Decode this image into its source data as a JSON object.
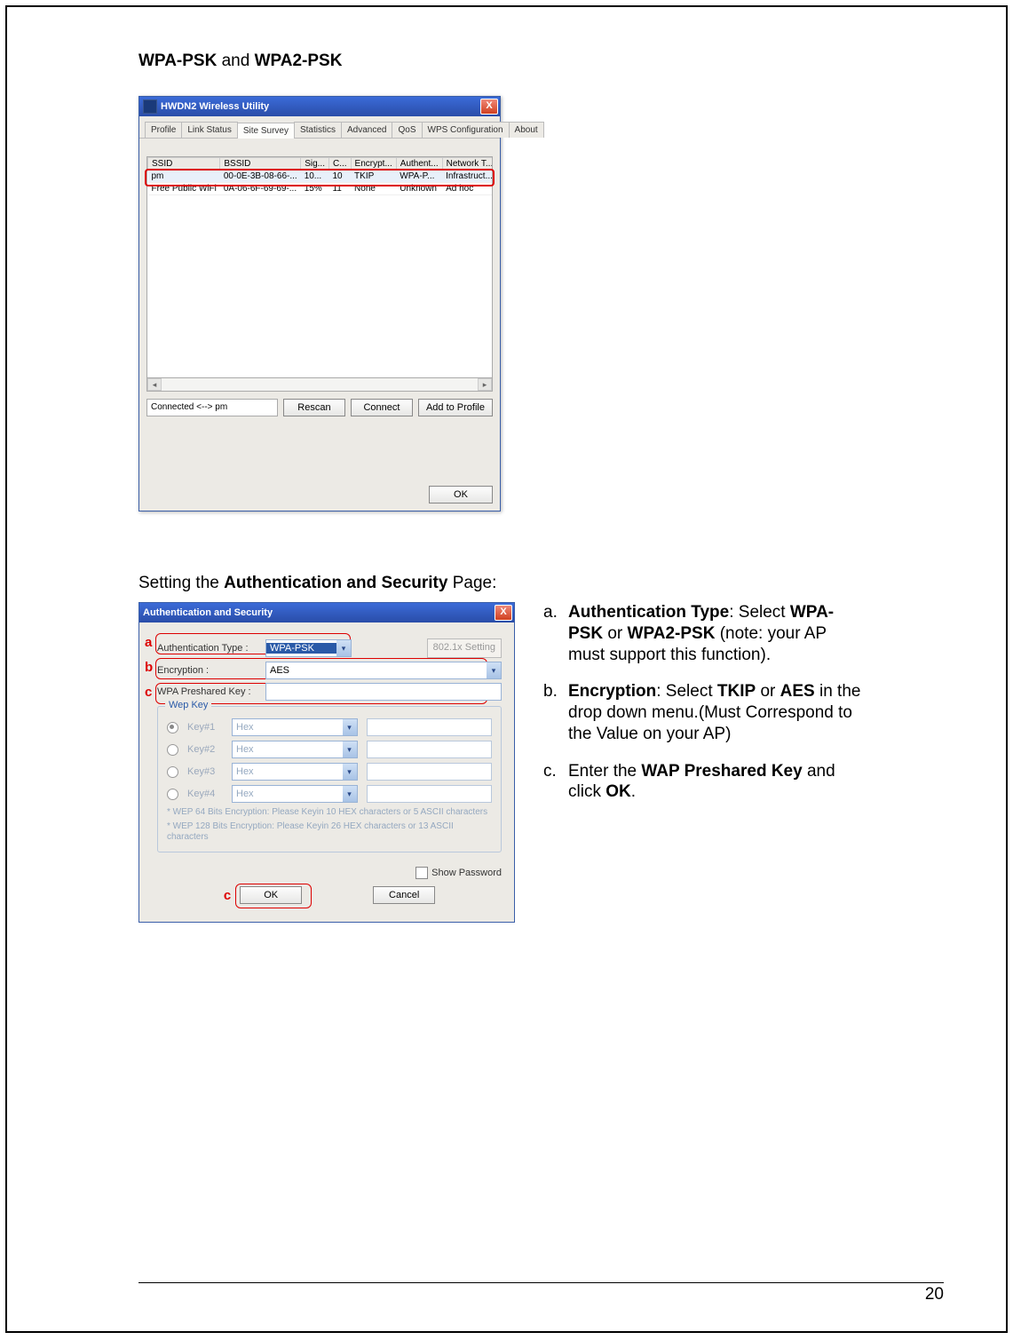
{
  "heading": {
    "p1": "WPA-PSK",
    "p2": " and ",
    "p3": "WPA2-PSK"
  },
  "win1": {
    "title": "HWDN2 Wireless Utility",
    "close": "X",
    "tabs": [
      "Profile",
      "Link Status",
      "Site Survey",
      "Statistics",
      "Advanced",
      "QoS",
      "WPS Configuration",
      "About"
    ],
    "activeTab": 2,
    "headers": [
      "SSID",
      "BSSID",
      "Sig...",
      "C...",
      "Encrypt...",
      "Authent...",
      "Network T..."
    ],
    "rows": [
      {
        "ssid": "pm",
        "bssid": "00-0E-3B-08-66-...",
        "sig": "10...",
        "ch": "10",
        "enc": "TKIP",
        "auth": "WPA-P...",
        "net": "Infrastruct..."
      },
      {
        "ssid": "Free Public WiFi",
        "bssid": "0A-06-6F-69-69-...",
        "sig": "15%",
        "ch": "11",
        "enc": "None",
        "auth": "Unknown",
        "net": "Ad hoc"
      }
    ],
    "status": "Connected <--> pm",
    "buttons": {
      "rescan": "Rescan",
      "connect": "Connect",
      "add": "Add to Profile",
      "ok": "OK"
    }
  },
  "section2": {
    "pre": "Setting the ",
    "b": "Authentication and Security",
    "post": " Page:"
  },
  "win2": {
    "title": "Authentication and Security",
    "close": "X",
    "authLabel": "Authentication Type :",
    "authValue": "WPA-PSK",
    "btn8021x": "802.1x Setting",
    "encLabel": "Encryption :",
    "encValue": "AES",
    "pskLabel": "WPA Preshared Key :",
    "wep": {
      "legend": "Wep Key",
      "keys": [
        "Key#1",
        "Key#2",
        "Key#3",
        "Key#4"
      ],
      "fmt": "Hex",
      "hint1": "* WEP 64 Bits Encryption:  Please Keyin 10 HEX characters or 5 ASCII characters",
      "hint2": "* WEP 128 Bits Encryption:  Please Keyin 26 HEX characters or 13 ASCII characters"
    },
    "showpwd": "Show Password",
    "ok": "OK",
    "cancel": "Cancel",
    "letters": {
      "a": "a",
      "b": "b",
      "c": "c"
    }
  },
  "instr": {
    "a_m": "a.",
    "a_1": "Authentication Type",
    "a_2": ": Select ",
    "a_3": "WPA-PSK",
    "a_4": " or ",
    "a_5": "WPA2-PSK",
    "a_6": " (note: your AP must support this function).",
    "b_m": "b.",
    "b_1": "Encryption",
    "b_2": ": Select ",
    "b_3": "TKIP",
    "b_4": " or ",
    "b_5": "AES",
    "b_6": " in the drop down menu.(Must Correspond to the Value on your AP)",
    "c_m": "c.",
    "c_1": "Enter the ",
    "c_2": "WAP Preshared Key",
    "c_3": " and click ",
    "c_4": "OK",
    "c_5": "."
  },
  "pagenum": "20"
}
